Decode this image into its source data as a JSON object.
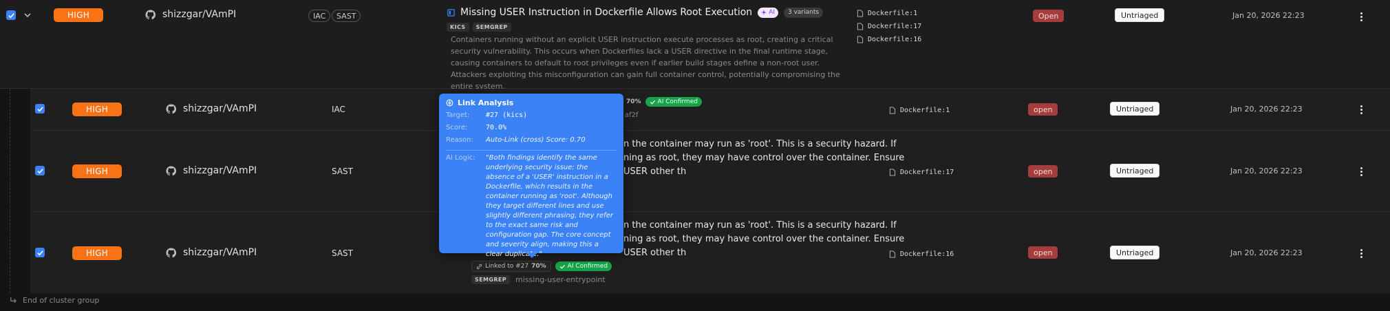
{
  "parent": {
    "severity": "HIGH",
    "repo": "shizzgar/VAmPI",
    "tags": [
      "IAC",
      "SAST"
    ],
    "title": "Missing USER Instruction in Dockerfile Allows Root Execution",
    "ai_label": "AI",
    "variants": "3 variants",
    "tools": [
      "KICS",
      "SEMGREP"
    ],
    "description": "Containers running without an explicit USER instruction execute processes as root, creating a critical security vulnerability. This occurs when Dockerfiles lack a USER directive in the final runtime stage, causing containers to default to root privileges even if earlier build stages define a non-root user. Attackers exploiting this misconfiguration can gain full container control, potentially compromising the entire system.",
    "files": [
      "Dockerfile:1",
      "Dockerfile:17",
      "Dockerfile:16"
    ],
    "status": "Open",
    "triage": "Untriaged",
    "date": "Jan 20, 2026 22:23"
  },
  "children": [
    {
      "severity": "HIGH",
      "repo": "shizzgar/VAmPI",
      "type": "IAC",
      "score": "70%",
      "confirm": "AI Confirmed",
      "hash_tail": "af2f",
      "file": "Dockerfile:1",
      "status": "open",
      "triage": "Untriaged",
      "date": "Jan 20, 2026 22:23"
    },
    {
      "severity": "HIGH",
      "repo": "shizzgar/VAmPI",
      "type": "SAST",
      "text_line1": "n the container may run as 'root'. This is a security hazard. If",
      "text_line2": "ning as root, they may have control over the container. Ensure",
      "text_line3": "USER other th",
      "file": "Dockerfile:17",
      "status": "open",
      "triage": "Untriaged",
      "date": "Jan 20, 2026 22:23"
    },
    {
      "severity": "HIGH",
      "repo": "shizzgar/VAmPI",
      "type": "SAST",
      "text_line1": "n the container may run as 'root'. This is a security hazard. If",
      "text_line2": "ning as root, they may have control over the container. Ensure",
      "text_line3": "USER other th",
      "linked": "Linked to #27",
      "score": "70%",
      "confirm": "AI Confirmed",
      "tool": "SEMGREP",
      "rule": "missing-user-entrypoint",
      "file": "Dockerfile:16",
      "status": "open",
      "triage": "Untriaged",
      "date": "Jan 20, 2026 22:23"
    }
  ],
  "tooltip": {
    "title": "Link Analysis",
    "target_label": "Target:",
    "target": "#27 (kics)",
    "score_label": "Score:",
    "score": "70.0%",
    "reason_label": "Reason:",
    "reason": "Auto-Link (cross) Score: 0.70",
    "logic_label": "AI Logic:",
    "logic": "\"Both findings identify the same underlying security issue: the absence of a 'USER' instruction in a Dockerfile, which results in the container running as 'root'. Although they target different lines and use slightly different phrasing, they refer to the exact same risk and configuration gap. The core concept and severity align, making this a clear duplicate.\""
  },
  "footer": {
    "end_group": "End of cluster group"
  },
  "colors": {
    "accent": "#3b82f6",
    "severity_high": "#f97316",
    "open": "#a63d3d",
    "confirmed": "#16a34a"
  }
}
